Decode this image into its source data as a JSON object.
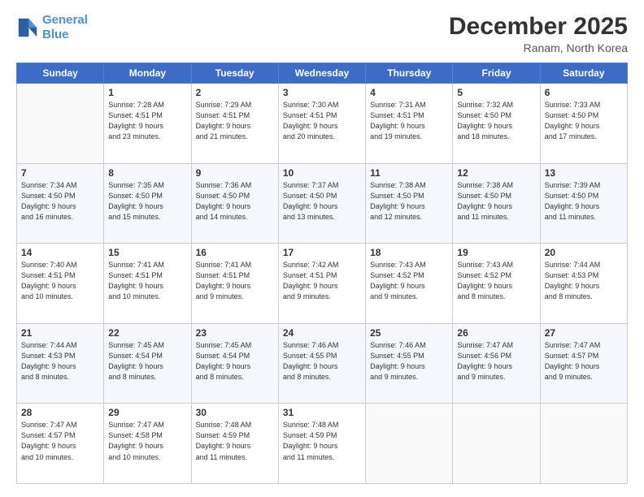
{
  "logo": {
    "line1": "General",
    "line2": "Blue"
  },
  "title": "December 2025",
  "subtitle": "Ranam, North Korea",
  "days_header": [
    "Sunday",
    "Monday",
    "Tuesday",
    "Wednesday",
    "Thursday",
    "Friday",
    "Saturday"
  ],
  "weeks": [
    [
      {
        "day": "",
        "info": ""
      },
      {
        "day": "1",
        "info": "Sunrise: 7:28 AM\nSunset: 4:51 PM\nDaylight: 9 hours\nand 23 minutes."
      },
      {
        "day": "2",
        "info": "Sunrise: 7:29 AM\nSunset: 4:51 PM\nDaylight: 9 hours\nand 21 minutes."
      },
      {
        "day": "3",
        "info": "Sunrise: 7:30 AM\nSunset: 4:51 PM\nDaylight: 9 hours\nand 20 minutes."
      },
      {
        "day": "4",
        "info": "Sunrise: 7:31 AM\nSunset: 4:51 PM\nDaylight: 9 hours\nand 19 minutes."
      },
      {
        "day": "5",
        "info": "Sunrise: 7:32 AM\nSunset: 4:50 PM\nDaylight: 9 hours\nand 18 minutes."
      },
      {
        "day": "6",
        "info": "Sunrise: 7:33 AM\nSunset: 4:50 PM\nDaylight: 9 hours\nand 17 minutes."
      }
    ],
    [
      {
        "day": "7",
        "info": "Sunrise: 7:34 AM\nSunset: 4:50 PM\nDaylight: 9 hours\nand 16 minutes."
      },
      {
        "day": "8",
        "info": "Sunrise: 7:35 AM\nSunset: 4:50 PM\nDaylight: 9 hours\nand 15 minutes."
      },
      {
        "day": "9",
        "info": "Sunrise: 7:36 AM\nSunset: 4:50 PM\nDaylight: 9 hours\nand 14 minutes."
      },
      {
        "day": "10",
        "info": "Sunrise: 7:37 AM\nSunset: 4:50 PM\nDaylight: 9 hours\nand 13 minutes."
      },
      {
        "day": "11",
        "info": "Sunrise: 7:38 AM\nSunset: 4:50 PM\nDaylight: 9 hours\nand 12 minutes."
      },
      {
        "day": "12",
        "info": "Sunrise: 7:38 AM\nSunset: 4:50 PM\nDaylight: 9 hours\nand 11 minutes."
      },
      {
        "day": "13",
        "info": "Sunrise: 7:39 AM\nSunset: 4:50 PM\nDaylight: 9 hours\nand 11 minutes."
      }
    ],
    [
      {
        "day": "14",
        "info": "Sunrise: 7:40 AM\nSunset: 4:51 PM\nDaylight: 9 hours\nand 10 minutes."
      },
      {
        "day": "15",
        "info": "Sunrise: 7:41 AM\nSunset: 4:51 PM\nDaylight: 9 hours\nand 10 minutes."
      },
      {
        "day": "16",
        "info": "Sunrise: 7:41 AM\nSunset: 4:51 PM\nDaylight: 9 hours\nand 9 minutes."
      },
      {
        "day": "17",
        "info": "Sunrise: 7:42 AM\nSunset: 4:51 PM\nDaylight: 9 hours\nand 9 minutes."
      },
      {
        "day": "18",
        "info": "Sunrise: 7:43 AM\nSunset: 4:52 PM\nDaylight: 9 hours\nand 9 minutes."
      },
      {
        "day": "19",
        "info": "Sunrise: 7:43 AM\nSunset: 4:52 PM\nDaylight: 9 hours\nand 8 minutes."
      },
      {
        "day": "20",
        "info": "Sunrise: 7:44 AM\nSunset: 4:53 PM\nDaylight: 9 hours\nand 8 minutes."
      }
    ],
    [
      {
        "day": "21",
        "info": "Sunrise: 7:44 AM\nSunset: 4:53 PM\nDaylight: 9 hours\nand 8 minutes."
      },
      {
        "day": "22",
        "info": "Sunrise: 7:45 AM\nSunset: 4:54 PM\nDaylight: 9 hours\nand 8 minutes."
      },
      {
        "day": "23",
        "info": "Sunrise: 7:45 AM\nSunset: 4:54 PM\nDaylight: 9 hours\nand 8 minutes."
      },
      {
        "day": "24",
        "info": "Sunrise: 7:46 AM\nSunset: 4:55 PM\nDaylight: 9 hours\nand 8 minutes."
      },
      {
        "day": "25",
        "info": "Sunrise: 7:46 AM\nSunset: 4:55 PM\nDaylight: 9 hours\nand 9 minutes."
      },
      {
        "day": "26",
        "info": "Sunrise: 7:47 AM\nSunset: 4:56 PM\nDaylight: 9 hours\nand 9 minutes."
      },
      {
        "day": "27",
        "info": "Sunrise: 7:47 AM\nSunset: 4:57 PM\nDaylight: 9 hours\nand 9 minutes."
      }
    ],
    [
      {
        "day": "28",
        "info": "Sunrise: 7:47 AM\nSunset: 4:57 PM\nDaylight: 9 hours\nand 10 minutes."
      },
      {
        "day": "29",
        "info": "Sunrise: 7:47 AM\nSunset: 4:58 PM\nDaylight: 9 hours\nand 10 minutes."
      },
      {
        "day": "30",
        "info": "Sunrise: 7:48 AM\nSunset: 4:59 PM\nDaylight: 9 hours\nand 11 minutes."
      },
      {
        "day": "31",
        "info": "Sunrise: 7:48 AM\nSunset: 4:59 PM\nDaylight: 9 hours\nand 11 minutes."
      },
      {
        "day": "",
        "info": ""
      },
      {
        "day": "",
        "info": ""
      },
      {
        "day": "",
        "info": ""
      }
    ]
  ]
}
